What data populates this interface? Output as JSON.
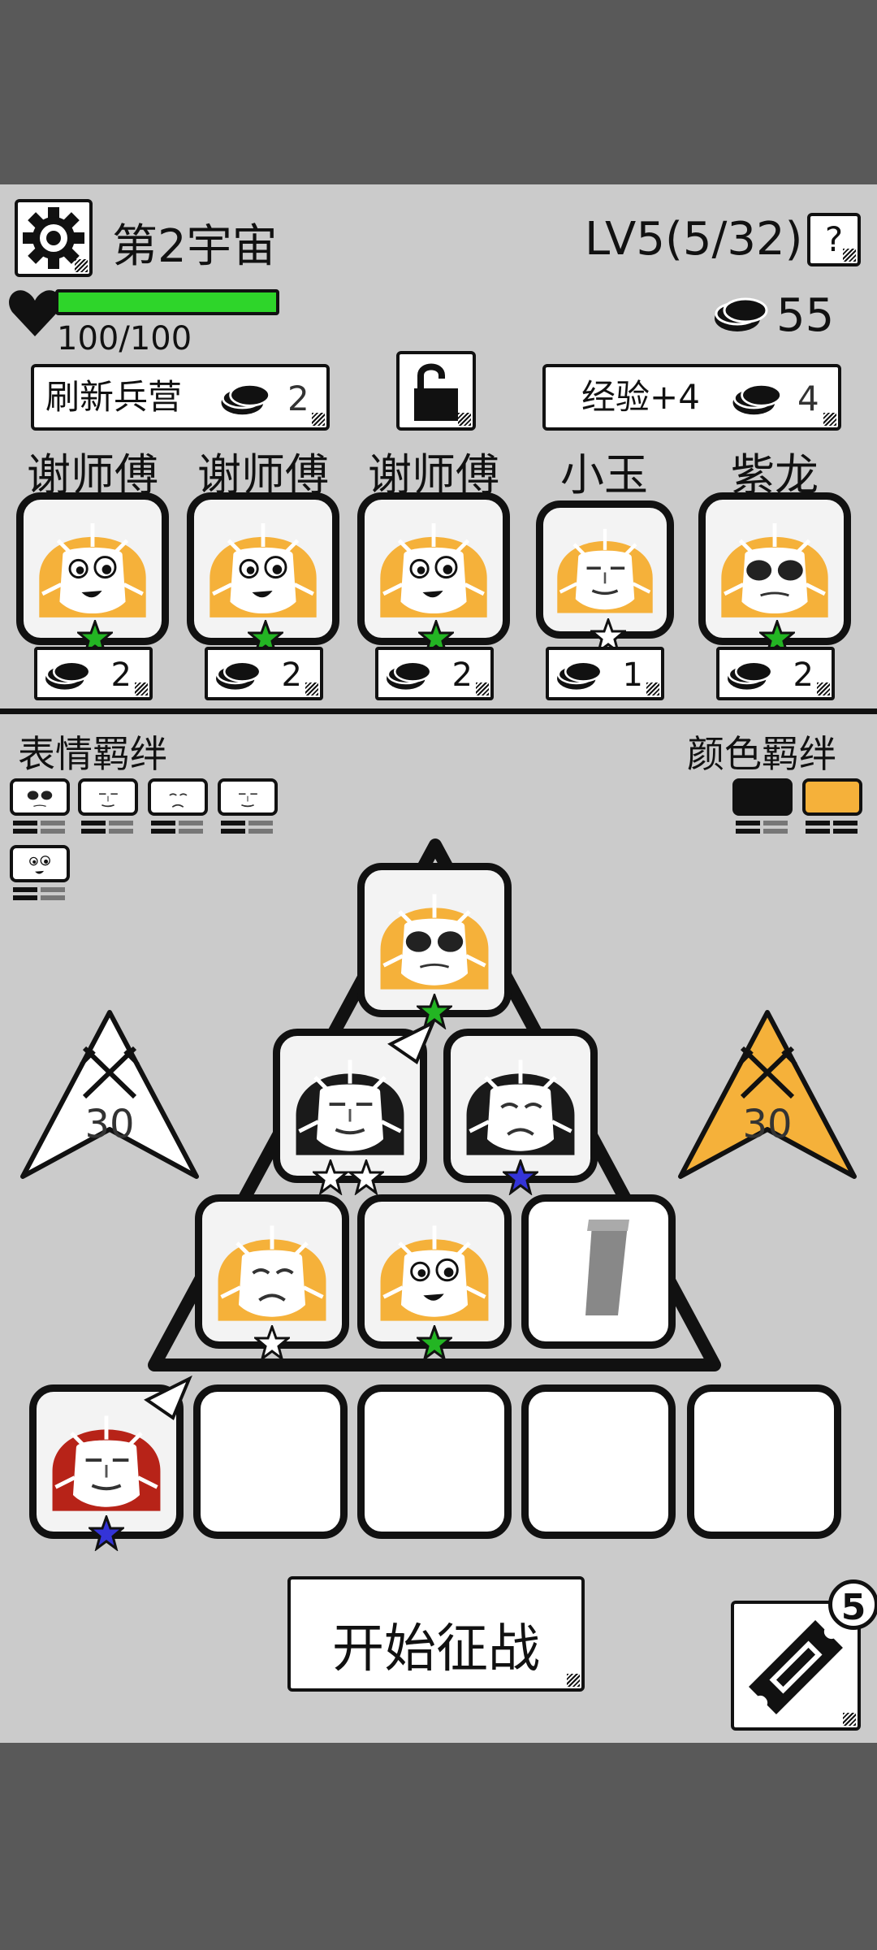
{
  "header": {
    "universe": "第2宇宙",
    "level": "LV5(5/32)",
    "help": "?",
    "hp": "100/100",
    "hp_fraction": 1.0,
    "coins": "55"
  },
  "toolbar": {
    "refresh_label": "刷新兵营",
    "refresh_cost": "2",
    "exp_label": "经验+4",
    "exp_cost": "4"
  },
  "shop": [
    {
      "name": "谢师傅",
      "cost": "2",
      "color": "#f5b13a",
      "star": "#23b523"
    },
    {
      "name": "谢师傅",
      "cost": "2",
      "color": "#f5b13a",
      "star": "#23b523"
    },
    {
      "name": "谢师傅",
      "cost": "2",
      "color": "#f5b13a",
      "star": "#23b523"
    },
    {
      "name": "小玉",
      "cost": "1",
      "color": "#f5b13a",
      "star": "#ffffff"
    },
    {
      "name": "紫龙",
      "cost": "2",
      "color": "#f5b13a",
      "star": "#23b523"
    }
  ],
  "bonds": {
    "expression_label": "表情羁绊",
    "color_label": "颜色羁绊",
    "color_chips": [
      "#111111",
      "#f5b13a"
    ]
  },
  "flags": {
    "left_value": "30",
    "right_value": "30",
    "left_color": "#ffffff",
    "right_color": "#f5b13a"
  },
  "actions": {
    "start_label": "开始征战",
    "ticket_count": "5"
  }
}
